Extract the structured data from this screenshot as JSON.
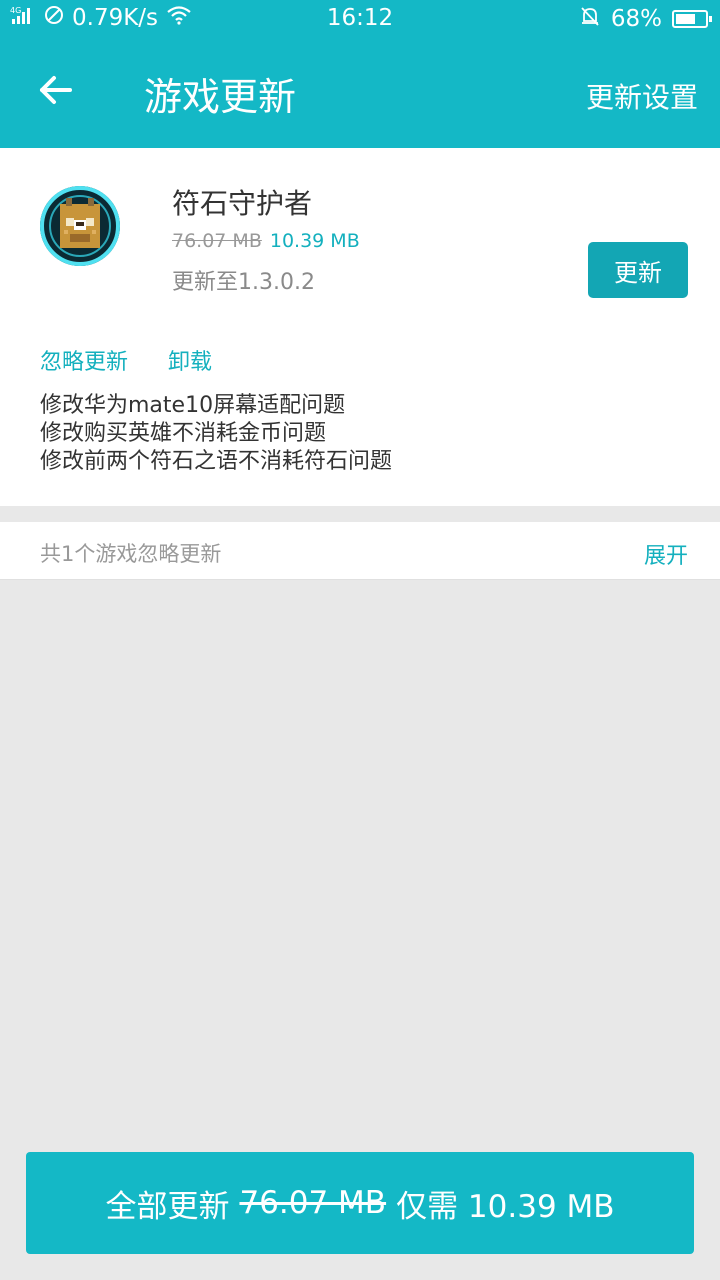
{
  "status": {
    "network": "4G",
    "speed": "0.79K/s",
    "time": "16:12",
    "battery": "68%",
    "battery_level": 0.68
  },
  "header": {
    "title": "游戏更新",
    "settings_label": "更新设置"
  },
  "app": {
    "name": "符石守护者",
    "old_size": "76.07 MB",
    "new_size": "10.39 MB",
    "version_text": "更新至1.3.0.2",
    "update_label": "更新",
    "ignore_label": "忽略更新",
    "uninstall_label": "卸载",
    "notes": [
      "修改华为mate10屏幕适配问题",
      "修改购买英雄不消耗金币问题",
      "修改前两个符石之语不消耗符石问题"
    ]
  },
  "ignored": {
    "summary": "共1个游戏忽略更新",
    "expand_label": "展开"
  },
  "bottom": {
    "prefix": "全部更新",
    "old_total": "76.07 MB",
    "suffix": "仅需 10.39 MB"
  },
  "colors": {
    "accent": "#14b8c6",
    "link": "#14b0be",
    "button": "#13a6b4"
  }
}
